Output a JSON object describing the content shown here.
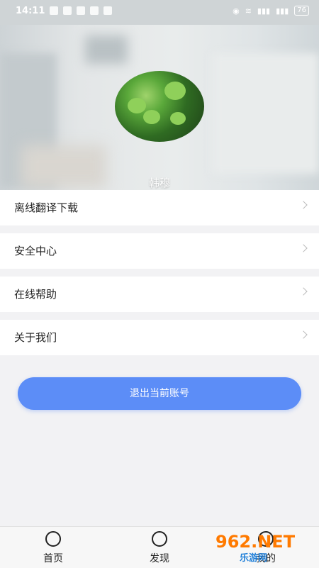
{
  "status_bar": {
    "time": "14:11",
    "battery": "76"
  },
  "profile": {
    "username": "韩穆"
  },
  "menu": [
    {
      "label": "离线翻译下载"
    },
    {
      "label": "安全中心"
    },
    {
      "label": "在线帮助"
    },
    {
      "label": "关于我们"
    }
  ],
  "logout_label": "退出当前账号",
  "tabs": [
    {
      "label": "首页",
      "icon": "home-icon"
    },
    {
      "label": "发现",
      "icon": "compass-icon"
    },
    {
      "label": "我的",
      "icon": "profile-icon"
    }
  ],
  "watermark": {
    "logo": "962.NET",
    "site": "乐游网"
  },
  "colors": {
    "accent": "#5c8df7",
    "background": "#f2f2f4"
  }
}
